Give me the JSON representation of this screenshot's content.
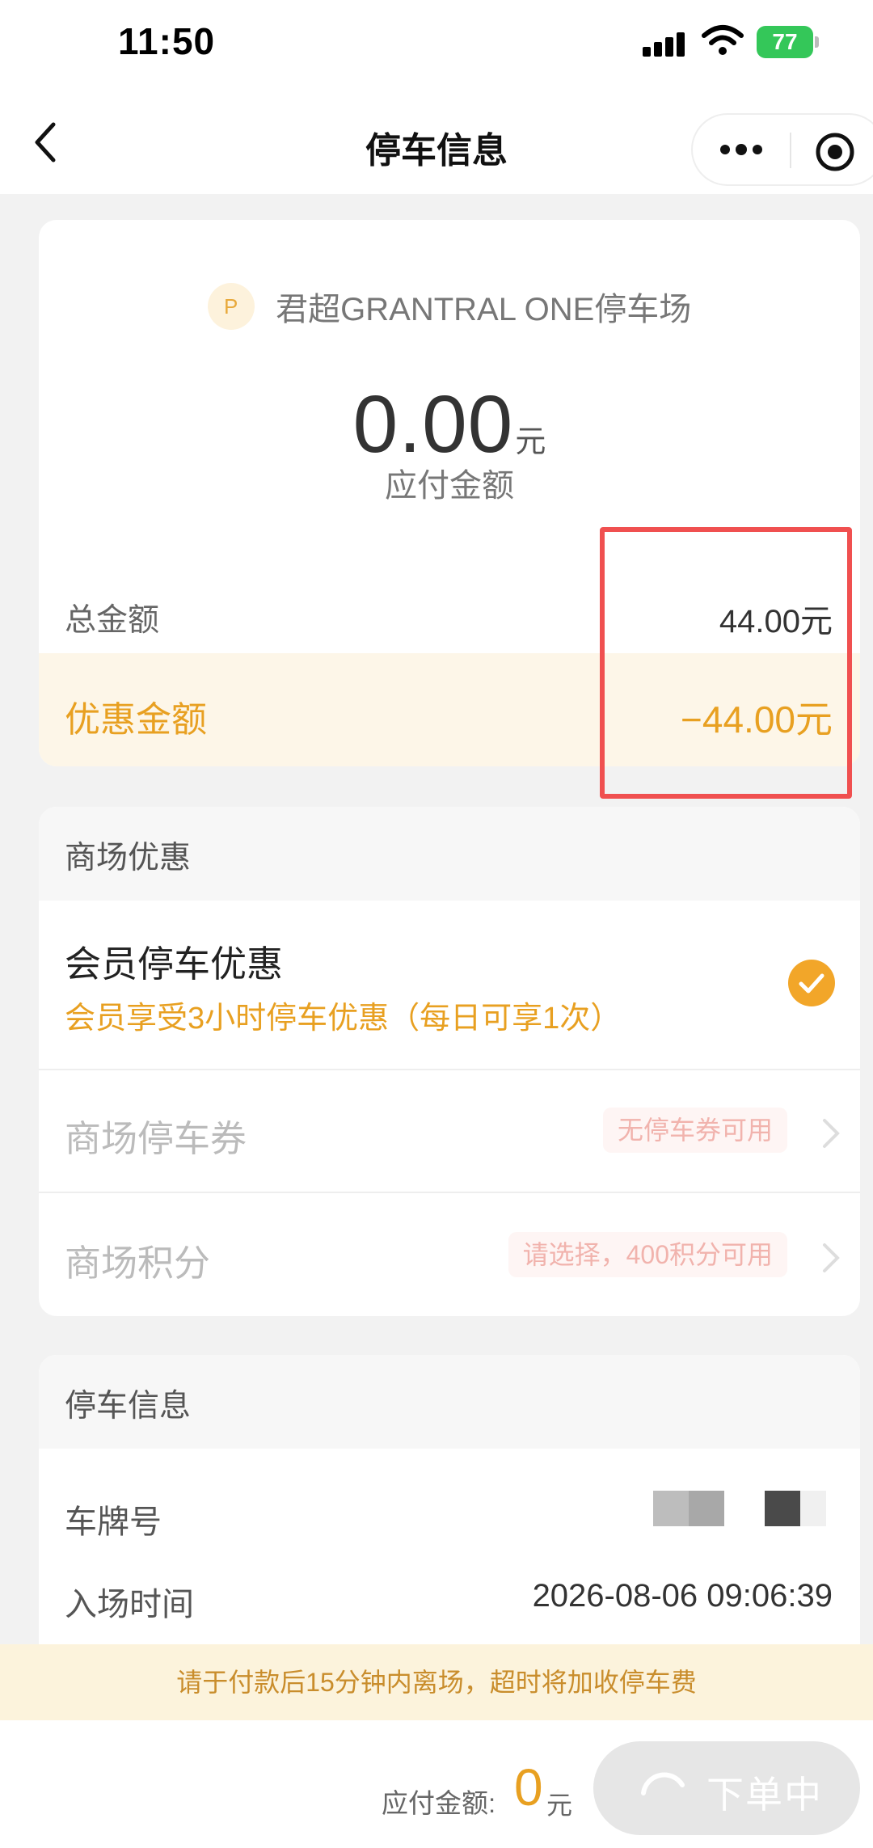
{
  "status_bar": {
    "time": "11:50",
    "battery": "77",
    "icons": [
      "signal-icon",
      "wifi-icon",
      "battery-icon"
    ]
  },
  "nav": {
    "title": "停车信息",
    "icons": [
      "back-icon",
      "more-icon",
      "target-icon"
    ]
  },
  "summary": {
    "lot_icon_letter": "P",
    "lot_name": "君超GRANTRAL ONE停车场",
    "amount_due": "0.00",
    "amount_unit": "元",
    "amount_label": "应付金额",
    "total_label": "总金额",
    "total_value": "44.00元",
    "discount_label": "优惠金额",
    "discount_value": "−44.00元"
  },
  "promotions": {
    "section_title": "商场优惠",
    "member": {
      "title": "会员停车优惠",
      "description": "会员享受3小时停车优惠（每日可享1次）",
      "selected": true
    },
    "coupon": {
      "label": "商场停车券",
      "badge": "无停车券可用"
    },
    "points": {
      "label": "商场积分",
      "badge": "请选择，400积分可用"
    }
  },
  "parking_info": {
    "section_title": "停车信息",
    "plate_label": "车牌号",
    "entry_label": "入场时间",
    "entry_time": "2026-08-06 09:06:39"
  },
  "notice": "请于付款后15分钟内离场，超时将加收停车费",
  "footer": {
    "pay_label": "应付金额:",
    "pay_value": "0",
    "pay_unit": "元",
    "submit_label": "下单中"
  },
  "colors": {
    "accent": "#e8a021",
    "highlight_box": "#f05050",
    "battery": "#34c759",
    "notice_bg": "#fcf3dc"
  }
}
